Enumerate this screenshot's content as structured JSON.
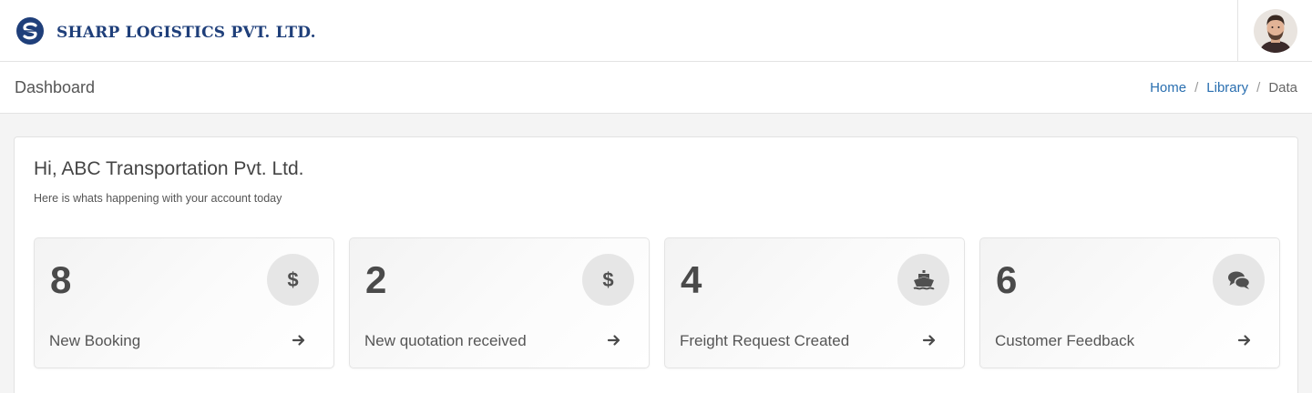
{
  "header": {
    "company_name": "SHARP LOGISTICS PVT. LTD.",
    "logo_icon": "logo-s-icon",
    "accent_color": "#1f3f7a"
  },
  "pagebar": {
    "title": "Dashboard",
    "breadcrumb": [
      "Home",
      "Library",
      "Data"
    ]
  },
  "welcome": {
    "greeting": "Hi, ABC Transportation Pvt. Ltd.",
    "subtitle": "Here is whats happening with your account today"
  },
  "cards": [
    {
      "count": "8",
      "label": "New Booking",
      "icon": "dollar-icon"
    },
    {
      "count": "2",
      "label": "New quotation received",
      "icon": "dollar-icon"
    },
    {
      "count": "4",
      "label": "Freight Request Created",
      "icon": "ship-icon"
    },
    {
      "count": "6",
      "label": "Customer Feedback",
      "icon": "comments-icon"
    }
  ]
}
